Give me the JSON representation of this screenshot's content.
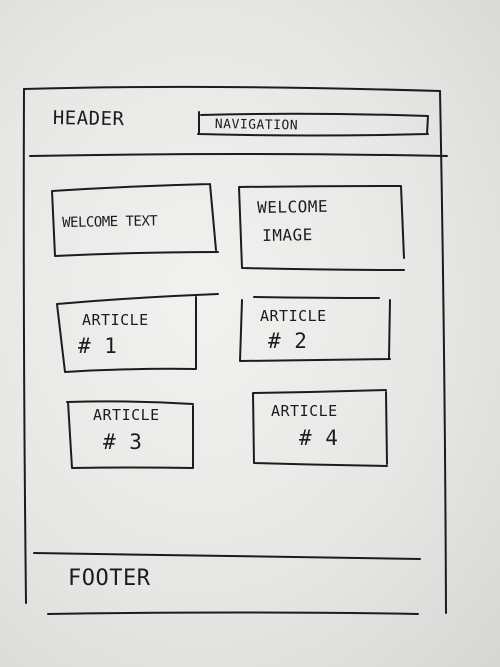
{
  "sketch": {
    "header": {
      "label": "HEADER",
      "navigation": "NAVIGATION"
    },
    "welcome": {
      "text": "WELCOME TEXT",
      "image_line1": "WELCOME",
      "image_line2": "IMAGE"
    },
    "articles": [
      {
        "title": "ARTICLE",
        "number": "# 1"
      },
      {
        "title": "ARTICLE",
        "number": "# 2"
      },
      {
        "title": "ARTICLE",
        "number": "# 3"
      },
      {
        "title": "ARTICLE",
        "number": "# 4"
      }
    ],
    "footer": {
      "label": "FOOTER"
    }
  }
}
